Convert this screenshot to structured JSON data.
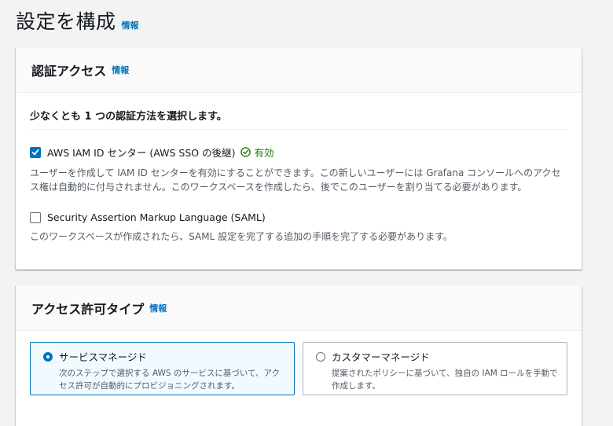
{
  "page": {
    "title": "設定を構成",
    "info_label": "情報"
  },
  "auth_panel": {
    "title": "認証アクセス",
    "info_label": "情報",
    "section_heading": "少なくとも 1 つの認証方法を選択します。",
    "options": [
      {
        "label": "AWS IAM ID センター (AWS SSO の後継)",
        "checked": true,
        "status": "有効",
        "status_color": "#1d8102",
        "description": "ユーザーを作成して IAM ID センターを有効にすることができます。この新しいユーザーには Grafana コンソールへのアクセス権は自動的に付与されません。このワークスペースを作成したら、後でこのユーザーを割り当てる必要があります。"
      },
      {
        "label": "Security Assertion Markup Language (SAML)",
        "checked": false,
        "description": "このワークスペースが作成されたら、SAML 設定を完了する追加の手順を完了する必要があります。"
      }
    ]
  },
  "access_panel": {
    "title": "アクセス許可タイプ",
    "info_label": "情報",
    "tiles": [
      {
        "label": "サービスマネージド",
        "selected": true,
        "description": "次のステップで選択する AWS のサービスに基づいて、アクセス許可が自動的にプロビジョニングされます。"
      },
      {
        "label": "カスタマーマネージド",
        "selected": false,
        "description": "提案されたポリシーに基づいて、独自の IAM ロールを手動で作成します。"
      }
    ]
  },
  "colors": {
    "accent": "#0073bb",
    "success": "#1d8102",
    "background": "#f2f3f3"
  }
}
